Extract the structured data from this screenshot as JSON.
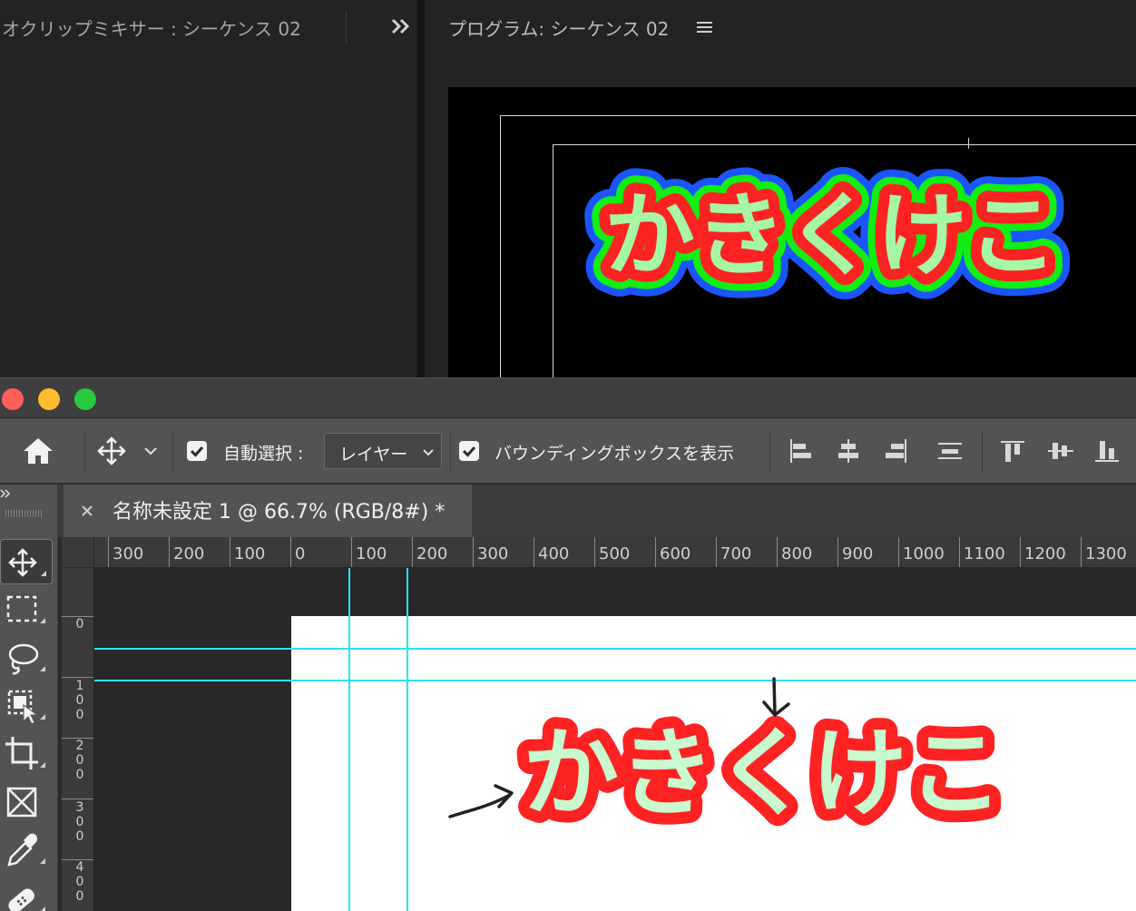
{
  "premiere": {
    "audio_mixer_title": "オクリップミキサー : シーケンス 02",
    "program_title": "プログラム: シーケンス 02",
    "monitor_text": "かきくけこ",
    "colors": {
      "fill": "#a6f7a4",
      "stroke_inner": "#ff2222",
      "stroke_mid": "#11ee11",
      "stroke_outer": "#1a55ff"
    }
  },
  "photoshop": {
    "options_bar": {
      "auto_select_label": "自動選択 :",
      "auto_select_value": "レイヤー",
      "bounding_box_label": "バウンディングボックスを表示"
    },
    "document_tab": {
      "title": "名称未設定 1 @ 66.7% (RGB/8#) *"
    },
    "ruler_h_labels": [
      "300",
      "200",
      "100",
      "0",
      "100",
      "200",
      "300",
      "400",
      "500",
      "600",
      "700",
      "800",
      "900",
      "1000",
      "1100",
      "1200",
      "1300"
    ],
    "ruler_v_labels": [
      "0",
      "100",
      "200",
      "300",
      "400"
    ],
    "canvas_text": "かきくけこ",
    "canvas_colors": {
      "fill": "#c9f9cf",
      "stroke": "#ff2222",
      "guide": "#27e4f0"
    }
  }
}
